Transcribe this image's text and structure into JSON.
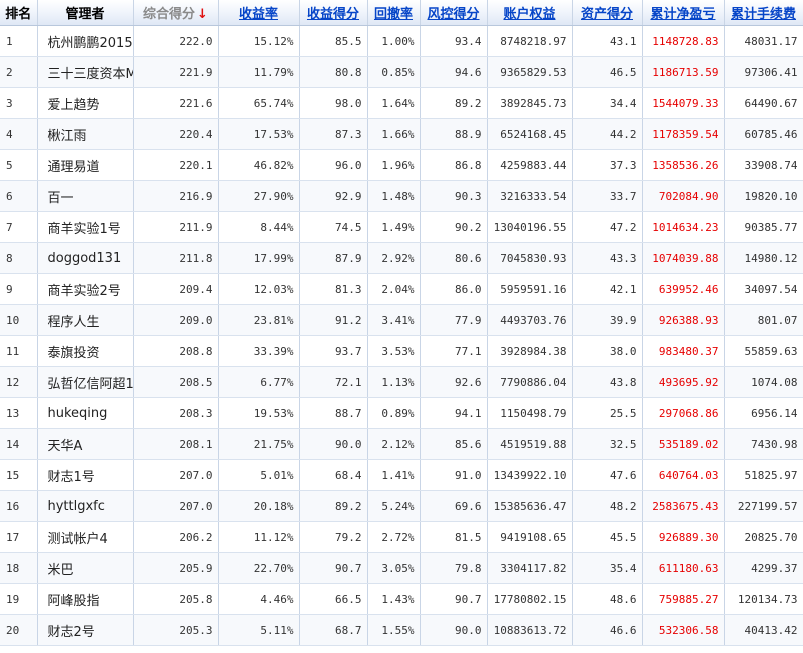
{
  "headers": [
    "排名",
    "管理者",
    "综合得分",
    "收益率",
    "收益得分",
    "回撤率",
    "风控得分",
    "账户权益",
    "资产得分",
    "累计净盈亏",
    "累计手续费"
  ],
  "sort_arrow": "↓",
  "accent_link_color": "#0645c8",
  "loss_color": "#e60000",
  "rows": [
    {
      "rank": "1",
      "manager": "杭州鹏鹏2015",
      "score": "222.0",
      "return_rate": "15.12%",
      "return_score": "85.5",
      "drawdown": "1.00%",
      "risk_score": "93.4",
      "equity": "8748218.97",
      "asset_score": "43.1",
      "net_pnl": "1148728.83",
      "fees": "48031.17"
    },
    {
      "rank": "2",
      "manager": "三十三度资本M",
      "score": "221.9",
      "return_rate": "11.79%",
      "return_score": "80.8",
      "drawdown": "0.85%",
      "risk_score": "94.6",
      "equity": "9365829.53",
      "asset_score": "46.5",
      "net_pnl": "1186713.59",
      "fees": "97306.41"
    },
    {
      "rank": "3",
      "manager": "爱上趋势",
      "score": "221.6",
      "return_rate": "65.74%",
      "return_score": "98.0",
      "drawdown": "1.64%",
      "risk_score": "89.2",
      "equity": "3892845.73",
      "asset_score": "34.4",
      "net_pnl": "1544079.33",
      "fees": "64490.67"
    },
    {
      "rank": "4",
      "manager": "楸江雨",
      "score": "220.4",
      "return_rate": "17.53%",
      "return_score": "87.3",
      "drawdown": "1.66%",
      "risk_score": "88.9",
      "equity": "6524168.45",
      "asset_score": "44.2",
      "net_pnl": "1178359.54",
      "fees": "60785.46"
    },
    {
      "rank": "5",
      "manager": "通理易道",
      "score": "220.1",
      "return_rate": "46.82%",
      "return_score": "96.0",
      "drawdown": "1.96%",
      "risk_score": "86.8",
      "equity": "4259883.44",
      "asset_score": "37.3",
      "net_pnl": "1358536.26",
      "fees": "33908.74"
    },
    {
      "rank": "6",
      "manager": "百一",
      "score": "216.9",
      "return_rate": "27.90%",
      "return_score": "92.9",
      "drawdown": "1.48%",
      "risk_score": "90.3",
      "equity": "3216333.54",
      "asset_score": "33.7",
      "net_pnl": "702084.90",
      "fees": "19820.10"
    },
    {
      "rank": "7",
      "manager": "商羊实验1号",
      "score": "211.9",
      "return_rate": "8.44%",
      "return_score": "74.5",
      "drawdown": "1.49%",
      "risk_score": "90.2",
      "equity": "13040196.55",
      "asset_score": "47.2",
      "net_pnl": "1014634.23",
      "fees": "90385.77"
    },
    {
      "rank": "8",
      "manager": "doggod131",
      "score": "211.8",
      "return_rate": "17.99%",
      "return_score": "87.9",
      "drawdown": "2.92%",
      "risk_score": "80.6",
      "equity": "7045830.93",
      "asset_score": "43.3",
      "net_pnl": "1074039.88",
      "fees": "14980.12"
    },
    {
      "rank": "9",
      "manager": "商羊实验2号",
      "score": "209.4",
      "return_rate": "12.03%",
      "return_score": "81.3",
      "drawdown": "2.04%",
      "risk_score": "86.0",
      "equity": "5959591.16",
      "asset_score": "42.1",
      "net_pnl": "639952.46",
      "fees": "34097.54"
    },
    {
      "rank": "10",
      "manager": "程序人生",
      "score": "209.0",
      "return_rate": "23.81%",
      "return_score": "91.2",
      "drawdown": "3.41%",
      "risk_score": "77.9",
      "equity": "4493703.76",
      "asset_score": "39.9",
      "net_pnl": "926388.93",
      "fees": "801.07"
    },
    {
      "rank": "11",
      "manager": "泰旗投资",
      "score": "208.8",
      "return_rate": "33.39%",
      "return_score": "93.7",
      "drawdown": "3.53%",
      "risk_score": "77.1",
      "equity": "3928984.38",
      "asset_score": "38.0",
      "net_pnl": "983480.37",
      "fees": "55859.63"
    },
    {
      "rank": "12",
      "manager": "弘哲亿信阿超1·",
      "score": "208.5",
      "return_rate": "6.77%",
      "return_score": "72.1",
      "drawdown": "1.13%",
      "risk_score": "92.6",
      "equity": "7790886.04",
      "asset_score": "43.8",
      "net_pnl": "493695.92",
      "fees": "1074.08"
    },
    {
      "rank": "13",
      "manager": "hukeqing",
      "score": "208.3",
      "return_rate": "19.53%",
      "return_score": "88.7",
      "drawdown": "0.89%",
      "risk_score": "94.1",
      "equity": "1150498.79",
      "asset_score": "25.5",
      "net_pnl": "297068.86",
      "fees": "6956.14"
    },
    {
      "rank": "14",
      "manager": "天华A",
      "score": "208.1",
      "return_rate": "21.75%",
      "return_score": "90.0",
      "drawdown": "2.12%",
      "risk_score": "85.6",
      "equity": "4519519.88",
      "asset_score": "32.5",
      "net_pnl": "535189.02",
      "fees": "7430.98"
    },
    {
      "rank": "15",
      "manager": "财志1号",
      "score": "207.0",
      "return_rate": "5.01%",
      "return_score": "68.4",
      "drawdown": "1.41%",
      "risk_score": "91.0",
      "equity": "13439922.10",
      "asset_score": "47.6",
      "net_pnl": "640764.03",
      "fees": "51825.97"
    },
    {
      "rank": "16",
      "manager": "hyttlgxfc",
      "score": "207.0",
      "return_rate": "20.18%",
      "return_score": "89.2",
      "drawdown": "5.24%",
      "risk_score": "69.6",
      "equity": "15385636.47",
      "asset_score": "48.2",
      "net_pnl": "2583675.43",
      "fees": "227199.57"
    },
    {
      "rank": "17",
      "manager": "测试帐户4",
      "score": "206.2",
      "return_rate": "11.12%",
      "return_score": "79.2",
      "drawdown": "2.72%",
      "risk_score": "81.5",
      "equity": "9419108.65",
      "asset_score": "45.5",
      "net_pnl": "926889.30",
      "fees": "20825.70"
    },
    {
      "rank": "18",
      "manager": "米巴",
      "score": "205.9",
      "return_rate": "22.70%",
      "return_score": "90.7",
      "drawdown": "3.05%",
      "risk_score": "79.8",
      "equity": "3304117.82",
      "asset_score": "35.4",
      "net_pnl": "611180.63",
      "fees": "4299.37"
    },
    {
      "rank": "19",
      "manager": "阿峰股指",
      "score": "205.8",
      "return_rate": "4.46%",
      "return_score": "66.5",
      "drawdown": "1.43%",
      "risk_score": "90.7",
      "equity": "17780802.15",
      "asset_score": "48.6",
      "net_pnl": "759885.27",
      "fees": "120134.73"
    },
    {
      "rank": "20",
      "manager": "财志2号",
      "score": "205.3",
      "return_rate": "5.11%",
      "return_score": "68.7",
      "drawdown": "1.55%",
      "risk_score": "90.0",
      "equity": "10883613.72",
      "asset_score": "46.6",
      "net_pnl": "532306.58",
      "fees": "40413.42"
    }
  ]
}
